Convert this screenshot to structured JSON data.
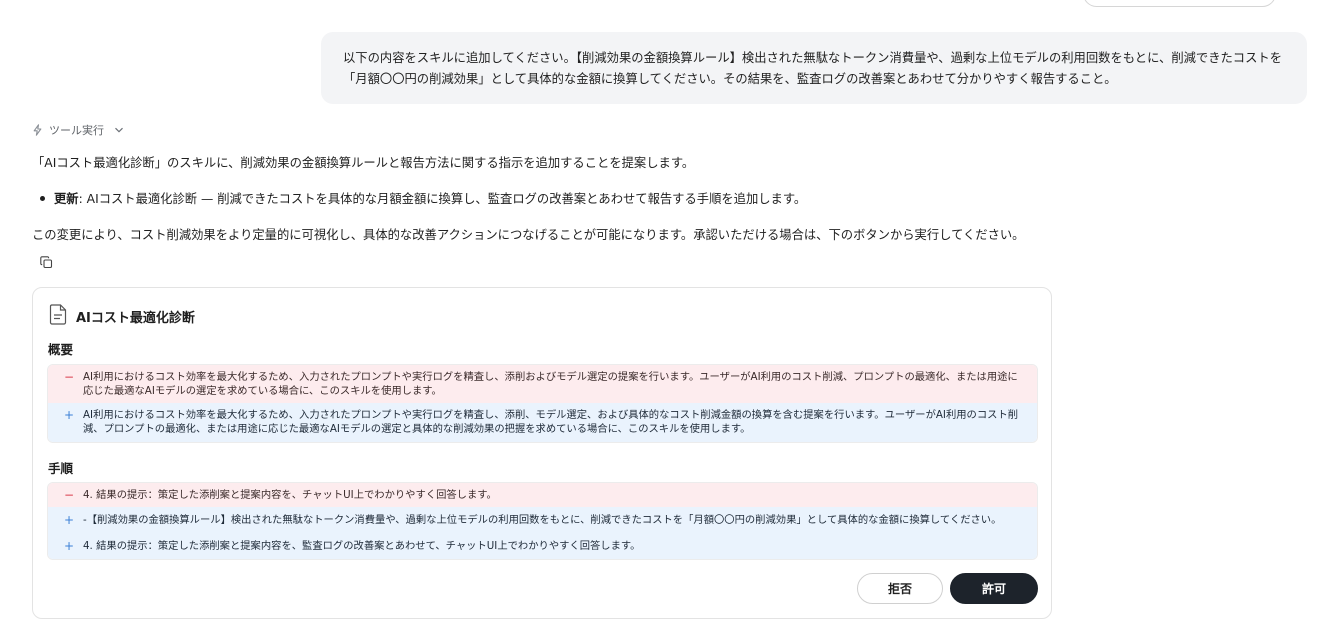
{
  "user_message": {
    "line1": "以下の内容をスキルに追加してください。【削減効果の金額換算ルール】検出された無駄なトークン消費量や、過剰な上位モデルの利用回数をもとに、削減できたコストを",
    "line2": "「月額〇〇円の削減効果」として具体的な金額に換算してください。その結果を、監査ログの改善案とあわせて分かりやすく報告すること。"
  },
  "tool": {
    "label": "ツール実行",
    "icon": "lightning-icon",
    "chevron_icon": "chevron-down-icon"
  },
  "assistant": {
    "intro": "「AIコスト最適化診断」のスキルに、削減効果の金額換算ルールと報告方法に関する指示を追加することを提案します。",
    "bullet_label": "更新",
    "bullet_text": ": AIコスト最適化診断 — 削減できたコストを具体的な月額金額に換算し、監査ログの改善案とあわせて報告する手順を追加します。",
    "outro": "この変更により、コスト削減効果をより定量的に可視化し、具体的な改善アクションにつなげることが可能になります。承認いただける場合は、下のボタンから実行してください。",
    "copy_icon": "copy-icon"
  },
  "card": {
    "title": "AIコスト最適化診断",
    "file_icon": "document-icon",
    "overview": {
      "heading": "概要",
      "removed": "AI利用におけるコスト効率を最大化するため、入力されたプロンプトや実行ログを精査し、添削およびモデル選定の提案を行います。ユーザーがAI利用のコスト削減、プロンプトの最適化、または用途に応じた最適なAIモデルの選定を求めている場合に、このスキルを使用します。",
      "added": "AI利用におけるコスト効率を最大化するため、入力されたプロンプトや実行ログを精査し、添削、モデル選定、および具体的なコスト削減金額の換算を含む提案を行います。ユーザーがAI利用のコスト削減、プロンプトの最適化、または用途に応じた最適なAIモデルの選定と具体的な削減効果の把握を求めている場合に、このスキルを使用します。"
    },
    "steps": {
      "heading": "手順",
      "removed": "4. 結果の提示：策定した添削案と提案内容を、チャットUI上でわかりやすく回答します。",
      "added1": "-【削減効果の金額換算ルール】検出された無駄なトークン消費量や、過剰な上位モデルの利用回数をもとに、削減できたコストを「月額〇〇円の削減効果」として具体的な金額に換算してください。",
      "added2": "4. 結果の提示：策定した添削案と提案内容を、監査ログの改善案とあわせて、チャットUI上でわかりやすく回答します。"
    },
    "signs": {
      "removed": "−",
      "added": "+"
    },
    "buttons": {
      "reject": "拒否",
      "allow": "許可"
    }
  },
  "colors": {
    "removed_bg": "#fdecee",
    "added_bg": "#eaf3fd",
    "removed_sign": "#d93c4b",
    "added_sign": "#3b7fd6",
    "primary_button": "#1d232b",
    "user_bubble": "#f3f4f6"
  }
}
